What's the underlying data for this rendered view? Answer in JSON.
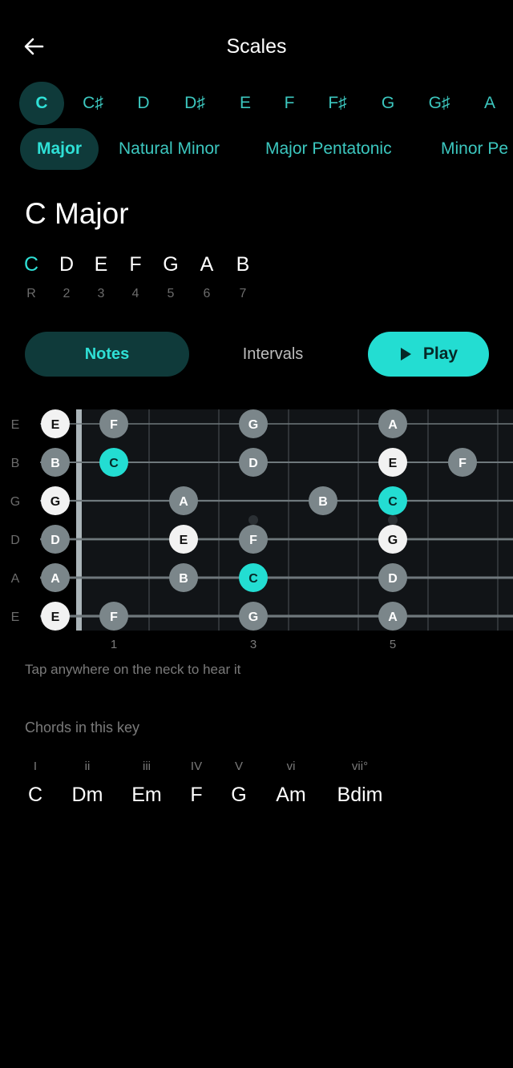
{
  "header": {
    "title": "Scales",
    "back_icon": "arrow-left-icon"
  },
  "keys": [
    "C",
    "C♯",
    "D",
    "D♯",
    "E",
    "F",
    "F♯",
    "G",
    "G♯",
    "A"
  ],
  "selected_key": "C",
  "scale_types": [
    "Major",
    "Natural Minor",
    "Major Pentatonic",
    "Minor Pe"
  ],
  "selected_scale_type": "Major",
  "scale_name": "C Major",
  "scale_notes": [
    {
      "note": "C",
      "degree": "R"
    },
    {
      "note": "D",
      "degree": "2"
    },
    {
      "note": "E",
      "degree": "3"
    },
    {
      "note": "F",
      "degree": "4"
    },
    {
      "note": "G",
      "degree": "5"
    },
    {
      "note": "A",
      "degree": "6"
    },
    {
      "note": "B",
      "degree": "7"
    }
  ],
  "tabs": {
    "notes": "Notes",
    "intervals": "Intervals",
    "play": "Play"
  },
  "fretboard": {
    "strings": [
      "E",
      "B",
      "G",
      "D",
      "A",
      "E"
    ],
    "fret_numbers": [
      "1",
      "3",
      "5"
    ],
    "notes": [
      {
        "string": 0,
        "fret": 0,
        "note": "E",
        "kind": "open"
      },
      {
        "string": 0,
        "fret": 1,
        "note": "F",
        "kind": "scale"
      },
      {
        "string": 0,
        "fret": 3,
        "note": "G",
        "kind": "scale"
      },
      {
        "string": 0,
        "fret": 5,
        "note": "A",
        "kind": "scale"
      },
      {
        "string": 1,
        "fret": 0,
        "note": "B",
        "kind": "scale"
      },
      {
        "string": 1,
        "fret": 1,
        "note": "C",
        "kind": "root"
      },
      {
        "string": 1,
        "fret": 3,
        "note": "D",
        "kind": "scale"
      },
      {
        "string": 1,
        "fret": 5,
        "note": "E",
        "kind": "open"
      },
      {
        "string": 1,
        "fret": 6,
        "note": "F",
        "kind": "scale"
      },
      {
        "string": 2,
        "fret": 0,
        "note": "G",
        "kind": "open"
      },
      {
        "string": 2,
        "fret": 2,
        "note": "A",
        "kind": "scale"
      },
      {
        "string": 2,
        "fret": 4,
        "note": "B",
        "kind": "scale"
      },
      {
        "string": 2,
        "fret": 5,
        "note": "C",
        "kind": "root"
      },
      {
        "string": 3,
        "fret": 0,
        "note": "D",
        "kind": "scale"
      },
      {
        "string": 3,
        "fret": 2,
        "note": "E",
        "kind": "open"
      },
      {
        "string": 3,
        "fret": 3,
        "note": "F",
        "kind": "scale"
      },
      {
        "string": 3,
        "fret": 5,
        "note": "G",
        "kind": "open"
      },
      {
        "string": 4,
        "fret": 0,
        "note": "A",
        "kind": "scale"
      },
      {
        "string": 4,
        "fret": 2,
        "note": "B",
        "kind": "scale"
      },
      {
        "string": 4,
        "fret": 3,
        "note": "C",
        "kind": "root"
      },
      {
        "string": 4,
        "fret": 5,
        "note": "D",
        "kind": "scale"
      },
      {
        "string": 5,
        "fret": 0,
        "note": "E",
        "kind": "open"
      },
      {
        "string": 5,
        "fret": 1,
        "note": "F",
        "kind": "scale"
      },
      {
        "string": 5,
        "fret": 3,
        "note": "G",
        "kind": "scale"
      },
      {
        "string": 5,
        "fret": 5,
        "note": "A",
        "kind": "scale"
      }
    ],
    "caption": "Tap anywhere on the neck to hear it"
  },
  "chords": {
    "label": "Chords in this key",
    "items": [
      {
        "numeral": "I",
        "name": "C"
      },
      {
        "numeral": "ii",
        "name": "Dm"
      },
      {
        "numeral": "iii",
        "name": "Em"
      },
      {
        "numeral": "IV",
        "name": "F"
      },
      {
        "numeral": "V",
        "name": "G"
      },
      {
        "numeral": "vi",
        "name": "Am"
      },
      {
        "numeral": "vii°",
        "name": "Bdim"
      }
    ]
  },
  "colors": {
    "accent": "#23ddd2",
    "accent_text": "#3cc7bf",
    "selected_bg": "#0f3a3a",
    "root_note": "#23ddd2",
    "open_note": "#f2f2f2",
    "scale_note": "#7b868a",
    "fretboard_bg": "#111417"
  }
}
